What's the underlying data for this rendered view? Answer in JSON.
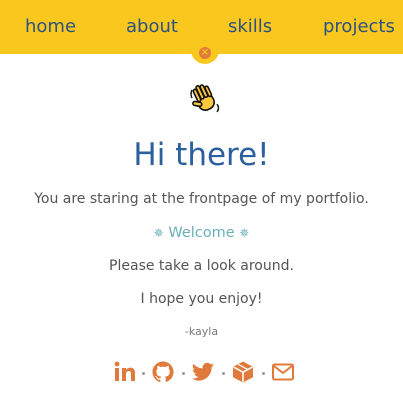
{
  "nav": {
    "links": [
      {
        "label": "home"
      },
      {
        "label": "about"
      },
      {
        "label": "skills"
      },
      {
        "label": "projects"
      }
    ],
    "toggle_icon": "close-icon"
  },
  "hero": {
    "emoji_icon": "waving-hand-icon",
    "title": "Hi there!",
    "intro": "You are staring at the frontpage of my portfolio.",
    "welcome": "Welcome",
    "look_around": "Please take a look around.",
    "enjoy": "I hope you enjoy!",
    "signature": "-kayla"
  },
  "social": {
    "icons": [
      "linkedin-icon",
      "github-icon",
      "twitter-icon",
      "codepen-icon",
      "email-icon"
    ]
  },
  "colors": {
    "navbar_bg": "#f9c71d",
    "nav_text": "#2c5283",
    "title": "#2c5f9e",
    "welcome": "#6ab0b8",
    "body_text": "#555555",
    "social_icons": "#e07a3c"
  }
}
